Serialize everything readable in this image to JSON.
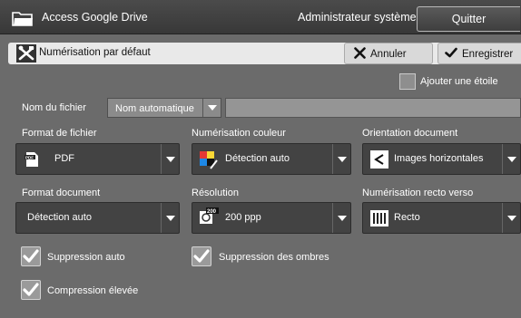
{
  "topbar": {
    "app_title": "Access Google Drive",
    "admin_label": "Administrateur système",
    "quit_label": "Quitter"
  },
  "header": {
    "title": "Numérisation par défaut",
    "cancel_label": "Annuler",
    "save_label": "Enregistrer"
  },
  "star_option": {
    "label": "Ajouter une étoile",
    "checked": false
  },
  "filename": {
    "label": "Nom du fichier",
    "mode": "Nom automatique",
    "value": ""
  },
  "file_format": {
    "label": "Format de fichier",
    "value": "PDF",
    "icon": "pdf-icon"
  },
  "color_scan": {
    "label": "Numérisation couleur",
    "value": "Détection auto",
    "icon": "color-detect-icon"
  },
  "orientation": {
    "label": "Orientation document",
    "value": "Images horizontales",
    "icon": "landscape-orientation-icon"
  },
  "doc_format": {
    "label": "Format document",
    "value": "Détection auto"
  },
  "resolution": {
    "label": "Résolution",
    "value": "200 ppp",
    "icon": "resolution-icon",
    "icon_text": "200"
  },
  "duplex": {
    "label": "Numérisation recto verso",
    "value": "Recto",
    "icon": "single-sided-icon"
  },
  "options": {
    "auto_suppression": {
      "label": "Suppression auto",
      "checked": true
    },
    "shadow_suppression": {
      "label": "Suppression des ombres",
      "checked": true
    },
    "high_compression": {
      "label": "Compression élevée",
      "checked": true
    }
  },
  "colors": {
    "panel_bg": "#6b6b6b",
    "topbar_bg": "#404040",
    "dropdown_bg": "#434343",
    "header_bg": "#e9e9e9"
  }
}
